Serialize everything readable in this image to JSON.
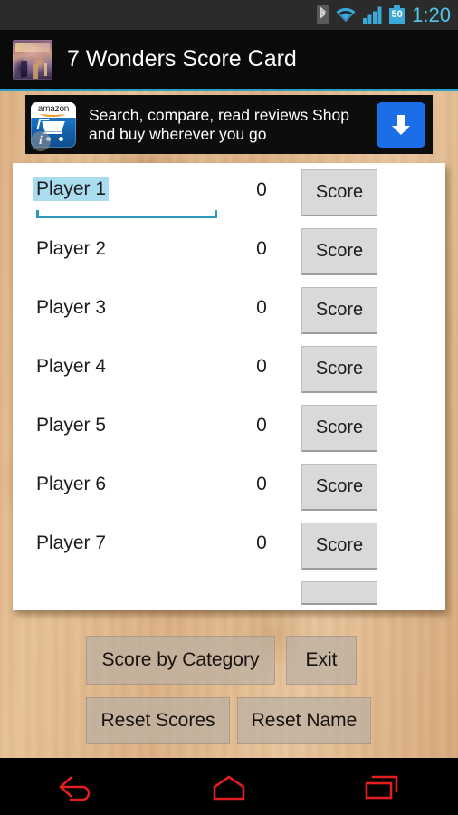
{
  "status_bar": {
    "time": "1:20",
    "battery_level": "50",
    "icons": [
      "bluetooth-icon",
      "wifi-icon",
      "cellular-signal-icon",
      "battery-icon"
    ],
    "accent_color": "#53c5e8",
    "background_color": "#2b2b2b"
  },
  "title_bar": {
    "app_name": "7 Wonders Score Card",
    "icon": "app-logo-icon",
    "background_color": "#0a0a0a",
    "divider_color": "#2b9fc4"
  },
  "ad_banner": {
    "advertiser": "amazon",
    "text": "Search, compare, read reviews Shop and buy wherever you go",
    "cta_icon": "download-arrow-icon",
    "cta_color": "#1c6ee8",
    "info_badge": "i"
  },
  "score_card": {
    "score_button_label": "Score",
    "rows": [
      {
        "name": "Player 1",
        "score": "0",
        "editing": true
      },
      {
        "name": "Player 2",
        "score": "0",
        "editing": false
      },
      {
        "name": "Player 3",
        "score": "0",
        "editing": false
      },
      {
        "name": "Player 4",
        "score": "0",
        "editing": false
      },
      {
        "name": "Player 5",
        "score": "0",
        "editing": false
      },
      {
        "name": "Player 6",
        "score": "0",
        "editing": false
      },
      {
        "name": "Player 7",
        "score": "0",
        "editing": false
      }
    ],
    "selection_highlight_color": "#a9dcef",
    "field_underline_color": "#2e9bbb",
    "button_color": "#d9d9d9"
  },
  "actions": {
    "score_by_category": "Score by Category",
    "exit": "Exit",
    "reset_scores": "Reset Scores",
    "reset_name": "Reset Name"
  },
  "nav_bar": {
    "icon_color": "#e02020",
    "buttons": [
      "back-icon",
      "home-icon",
      "recents-icon"
    ]
  }
}
